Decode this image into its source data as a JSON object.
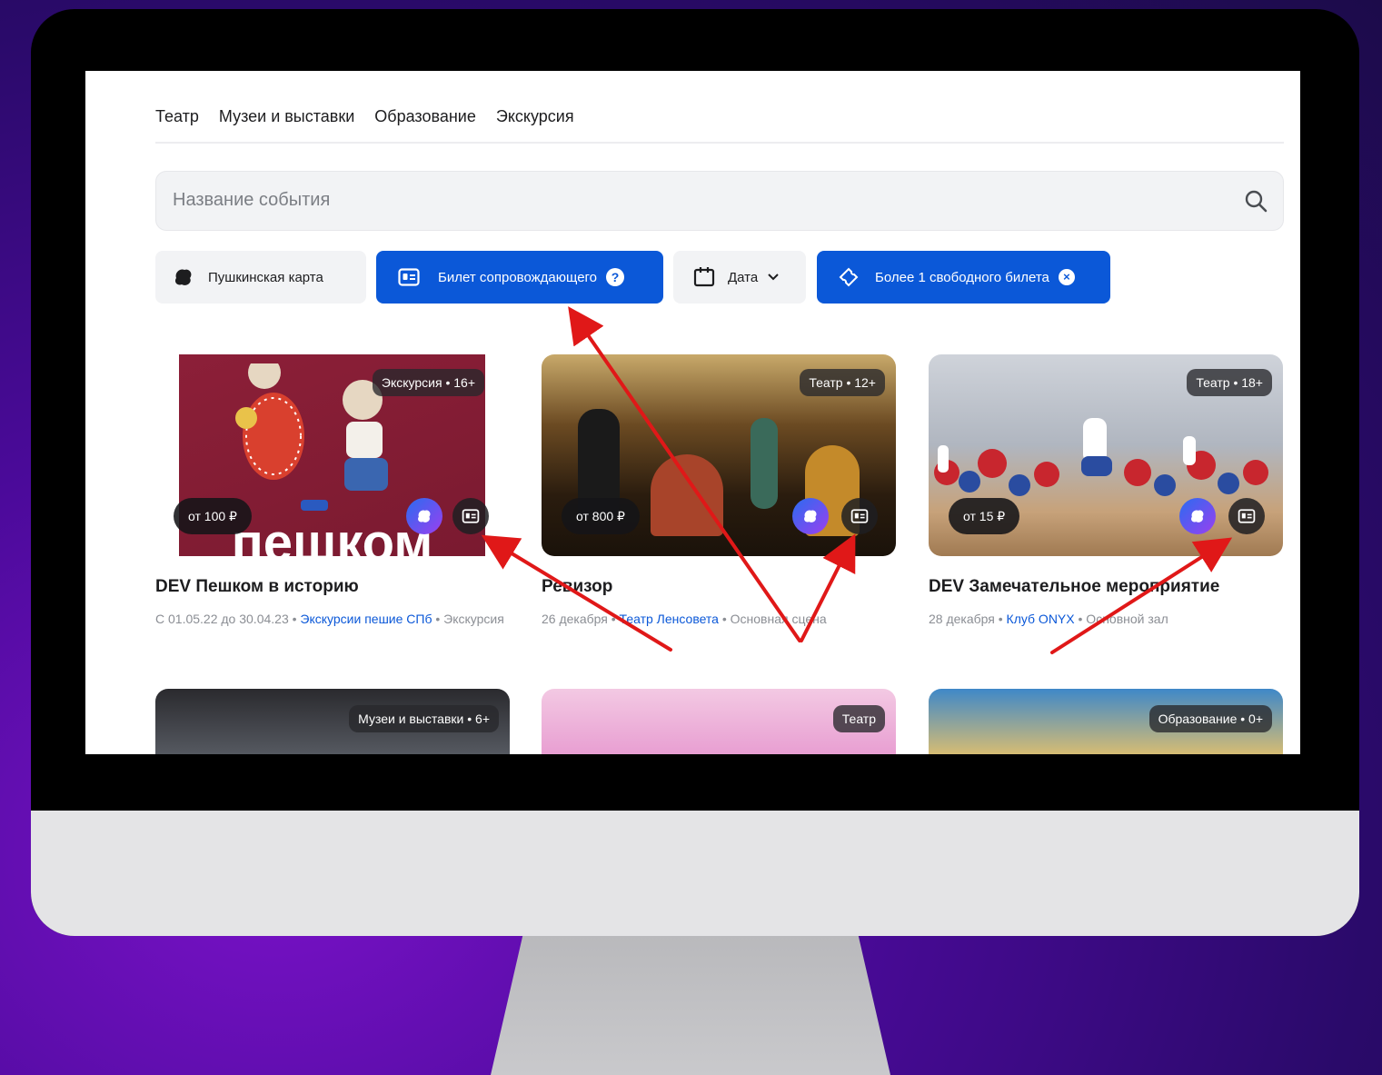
{
  "tabs": [
    "Театр",
    "Музеи и выставки",
    "Образование",
    "Экскурсия"
  ],
  "search": {
    "placeholder": "Название события"
  },
  "filters": {
    "pushkin": "Пушкинская карта",
    "companion": "Билет сопровождающего",
    "date": "Дата",
    "free_tickets": "Более 1 свободного билета"
  },
  "cards": [
    {
      "tag": "Экскурсия • 16+",
      "price": "от 100 ₽",
      "overlay_text": "пешком",
      "title": "DEV Пешком в историю",
      "meta_before": "С 01.05.22 до 30.04.23 • ",
      "meta_link": "Экскурсии пешие СПб",
      "meta_after": " • Экскурсия"
    },
    {
      "tag": "Театр • 12+",
      "price": "от 800 ₽",
      "title": "Ревизор",
      "meta_before": "26 декабря • ",
      "meta_link": "Театр Ленсовета",
      "meta_after": " • Основная сцена"
    },
    {
      "tag": "Театр • 18+",
      "price": "от 15 ₽",
      "title": "DEV Замечательное мероприятие",
      "meta_before": "28 декабря • ",
      "meta_link": "Клуб ONYX",
      "meta_after": " • Основной зал"
    }
  ],
  "row2_tags": [
    "Музеи и выставки • 6+",
    "Театр",
    "Образование • 0+"
  ],
  "colors": {
    "accent": "#0b58d8",
    "arrow": "#e01818",
    "background": "#5a0fb0"
  }
}
